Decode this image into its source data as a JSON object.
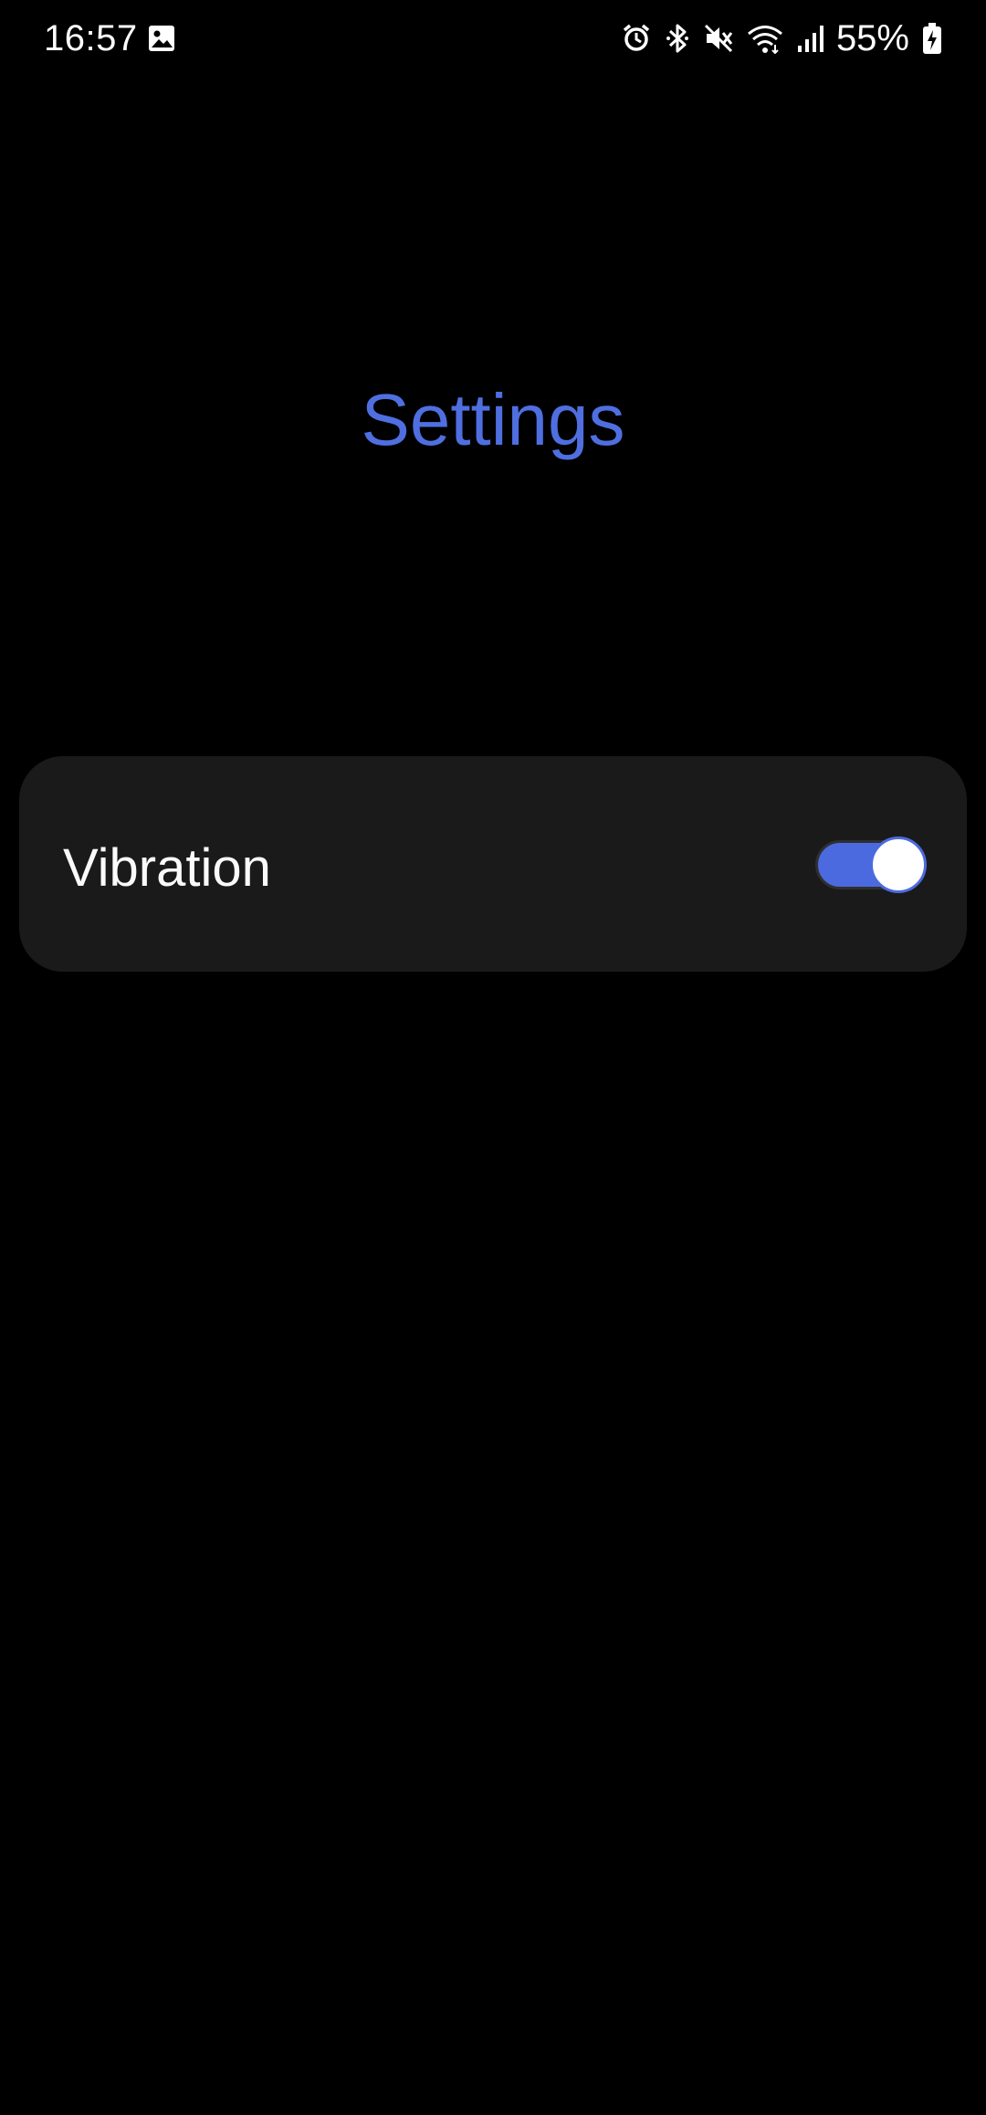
{
  "status_bar": {
    "time": "16:57",
    "battery": "55%",
    "icons": [
      "gallery-icon",
      "alarm-icon",
      "bluetooth-icon",
      "muted-icon",
      "wifi-icon",
      "signal-icon",
      "battery-charging-icon"
    ]
  },
  "page": {
    "title": "Settings"
  },
  "settings": {
    "vibration": {
      "label": "Vibration",
      "enabled": true
    }
  },
  "colors": {
    "accent": "#4f6fe0",
    "background": "#000000",
    "card": "#1a1a1a"
  }
}
